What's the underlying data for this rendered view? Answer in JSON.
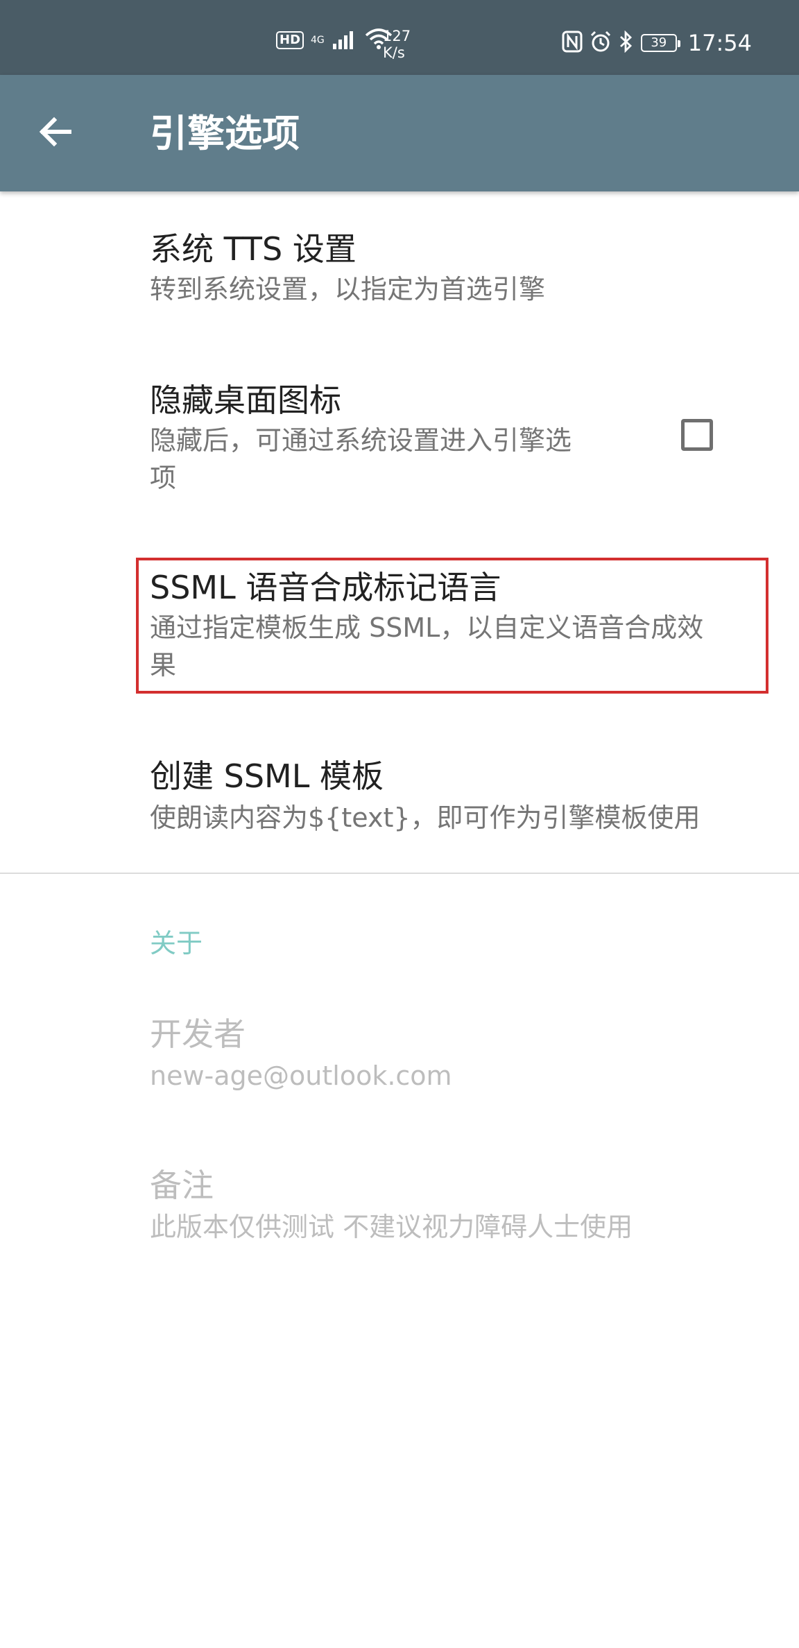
{
  "status_bar": {
    "hd": "HD",
    "network": "4G",
    "speed_value": "127",
    "speed_unit": "K/s",
    "battery": "39",
    "time": "17:54",
    "icons": [
      "nfc-icon",
      "alarm-icon",
      "bluetooth-icon",
      "wifi-icon",
      "signal-icon"
    ]
  },
  "app_bar": {
    "title": "引擎选项",
    "back_icon": "arrow-left-icon",
    "color": "#607d8b"
  },
  "preferences": [
    {
      "title": "系统 TTS 设置",
      "summary": "转到系统设置，以指定为首选引擎"
    },
    {
      "title": "隐藏桌面图标",
      "summary_line1": "隐藏后，可通过系统设置进入引擎选",
      "summary_line2": "项",
      "checked": false
    },
    {
      "title": "SSML 语音合成标记语言",
      "summary_line1": "通过指定模板生成 SSML，以自定义语音合成效",
      "summary_line2": "果",
      "highlighted": true,
      "highlight_color": "#d32f2f"
    },
    {
      "title": "创建 SSML 模板",
      "summary": "使朗读内容为${text}，即可作为引擎模板使用"
    }
  ],
  "about": {
    "category": "关于",
    "category_color": "#80cbc4",
    "items": [
      {
        "title": "开发者",
        "summary": "new-age@outlook.com"
      },
      {
        "title": "备注",
        "summary": "此版本仅供测试 不建议视力障碍人士使用"
      }
    ]
  }
}
